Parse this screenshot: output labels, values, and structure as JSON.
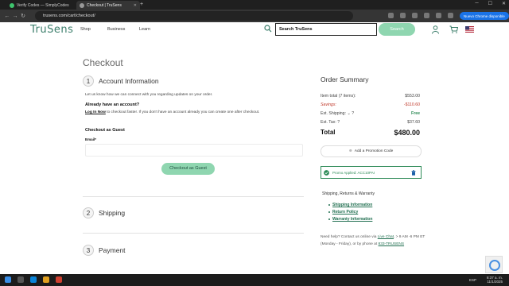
{
  "browser": {
    "tabs": [
      {
        "label": "Verify Codes — SimplyCodes"
      },
      {
        "label": "Checkout | TruSens"
      }
    ],
    "url": "trusens.com/cart/checkout/",
    "chrome_pill": "Nuevo Chrome disponible"
  },
  "header": {
    "logo": "TruSens",
    "nav": [
      "Shop",
      "Business",
      "Learn"
    ],
    "search_value": "Search TruSens",
    "search_button": "Search"
  },
  "checkout": {
    "title": "Checkout",
    "steps": [
      {
        "num": "1",
        "label": "Account Information"
      },
      {
        "num": "2",
        "label": "Shipping"
      },
      {
        "num": "3",
        "label": "Payment"
      }
    ],
    "intro": "Let us know how we can connect with you regarding updates on your order.",
    "have_account": "Already have an account?",
    "login_link": "Log In Now",
    "login_rest": " to checkout faster. If you don't have an account already you can create one after checkout.",
    "guest_heading": "Checkout as Guest",
    "email_label": "Email*",
    "guest_button": "Checkout as Guest"
  },
  "summary": {
    "title": "Order Summary",
    "item_total_label": "Item total (7 items):",
    "item_total_value": "$553.00",
    "savings_label": "Savings:",
    "savings_value": "-$110.60",
    "shipping_label": "Est. Shipping:",
    "shipping_value": "Free",
    "tax_label": "Est. Tax:",
    "tax_value": "$37.60",
    "total_label": "Total",
    "total_value": "$480.00",
    "promo_button": "Add a Promotion Code",
    "promo_applied": "Promo Applied: ACC10PAI",
    "ship_heading": "Shipping, Returns & Warranty",
    "ship_links": [
      "Shipping Information",
      "Return Policy",
      "Warranty Information"
    ],
    "help_pre": "Need help? Contact us online via ",
    "help_chat": "Live Chat",
    "help_mid": ", > 9 AM -6 PM ET (Monday - Friday), or by phone at ",
    "help_phone": "833-TRUSENS"
  },
  "taskbar": {
    "lang": "ESP",
    "time": "8:37 a. m.",
    "date": "11/1/2025"
  },
  "colors": {
    "brand": "#3a7d6a",
    "mint": "#8fd6b0",
    "red": "#c0392b",
    "green": "#2e8b57"
  }
}
